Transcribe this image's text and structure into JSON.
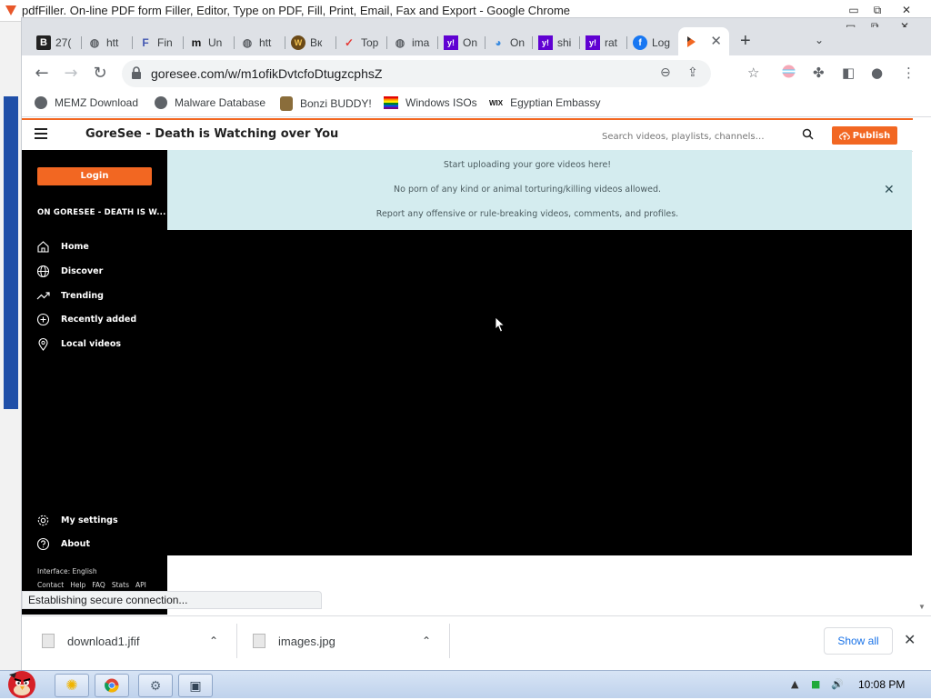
{
  "background_window": {
    "title": "pdfFiller. On-line PDF form Filler, Editor, Type on PDF, Fill, Print, Email, Fax and Export - Google Chrome"
  },
  "browser": {
    "tabs": [
      {
        "label": "27(",
        "icon": "b-square-icon"
      },
      {
        "label": "htt",
        "icon": "globe-icon"
      },
      {
        "label": "Fin",
        "icon": "f-logo-icon"
      },
      {
        "label": "Un",
        "icon": "m-logo-icon"
      },
      {
        "label": "htt",
        "icon": "globe-icon"
      },
      {
        "label": "Bк",
        "icon": "wolf-logo-icon"
      },
      {
        "label": "Top",
        "icon": "checkmark-icon"
      },
      {
        "label": "ima",
        "icon": "globe-icon"
      },
      {
        "label": "On",
        "icon": "yahoo-icon"
      },
      {
        "label": "On",
        "icon": "blue-logo-icon"
      },
      {
        "label": "shi",
        "icon": "yahoo-icon"
      },
      {
        "label": "rat",
        "icon": "yahoo-icon"
      },
      {
        "label": "Log",
        "icon": "facebook-icon"
      },
      {
        "label": "",
        "icon": "goresee-play-icon",
        "active": true
      }
    ],
    "url": "goresee.com/w/m1ofikDvtcfoDtugzcphsZ",
    "bookmarks": [
      {
        "label": "MEMZ Download",
        "icon": "globe-icon"
      },
      {
        "label": "Malware Database",
        "icon": "globe-icon"
      },
      {
        "label": "Bonzi BUDDY!",
        "icon": "bonzi-icon"
      },
      {
        "label": "Windows ISOs",
        "icon": "windows-flag-icon"
      },
      {
        "label": "Egyptian Embassy",
        "icon": "wix-icon"
      }
    ],
    "status_text": "Establishing secure connection...",
    "downloads": [
      {
        "filename": "download1.jfif"
      },
      {
        "filename": "images.jpg"
      }
    ],
    "show_all_label": "Show all"
  },
  "site": {
    "title": "GoreSee - Death is Watching over You",
    "search_placeholder": "Search videos, playlists, channels…",
    "publish_label": "Publish",
    "login_label": "Login",
    "sidebar_heading": "ON GORESEE - DEATH IS W...",
    "nav_items": [
      {
        "label": "Home",
        "icon": "home-icon"
      },
      {
        "label": "Discover",
        "icon": "globe-icon"
      },
      {
        "label": "Trending",
        "icon": "trending-icon"
      },
      {
        "label": "Recently added",
        "icon": "plus-circle-icon"
      },
      {
        "label": "Local videos",
        "icon": "map-pin-icon"
      }
    ],
    "settings_items": [
      {
        "label": "My settings",
        "icon": "gear-icon"
      },
      {
        "label": "About",
        "icon": "help-circle-icon"
      }
    ],
    "footer_interface": "Interface: English",
    "footer_links": [
      "Contact",
      "Help",
      "FAQ",
      "Stats",
      "API"
    ],
    "notice_lines": [
      "Start uploading your gore videos here!",
      "No porn of any kind or animal torturing/killing videos allowed.",
      "Report any offensive or rule-breaking videos, comments, and profiles."
    ],
    "accent_color": "#f26722"
  },
  "taskbar": {
    "clock": "10:08 PM"
  }
}
